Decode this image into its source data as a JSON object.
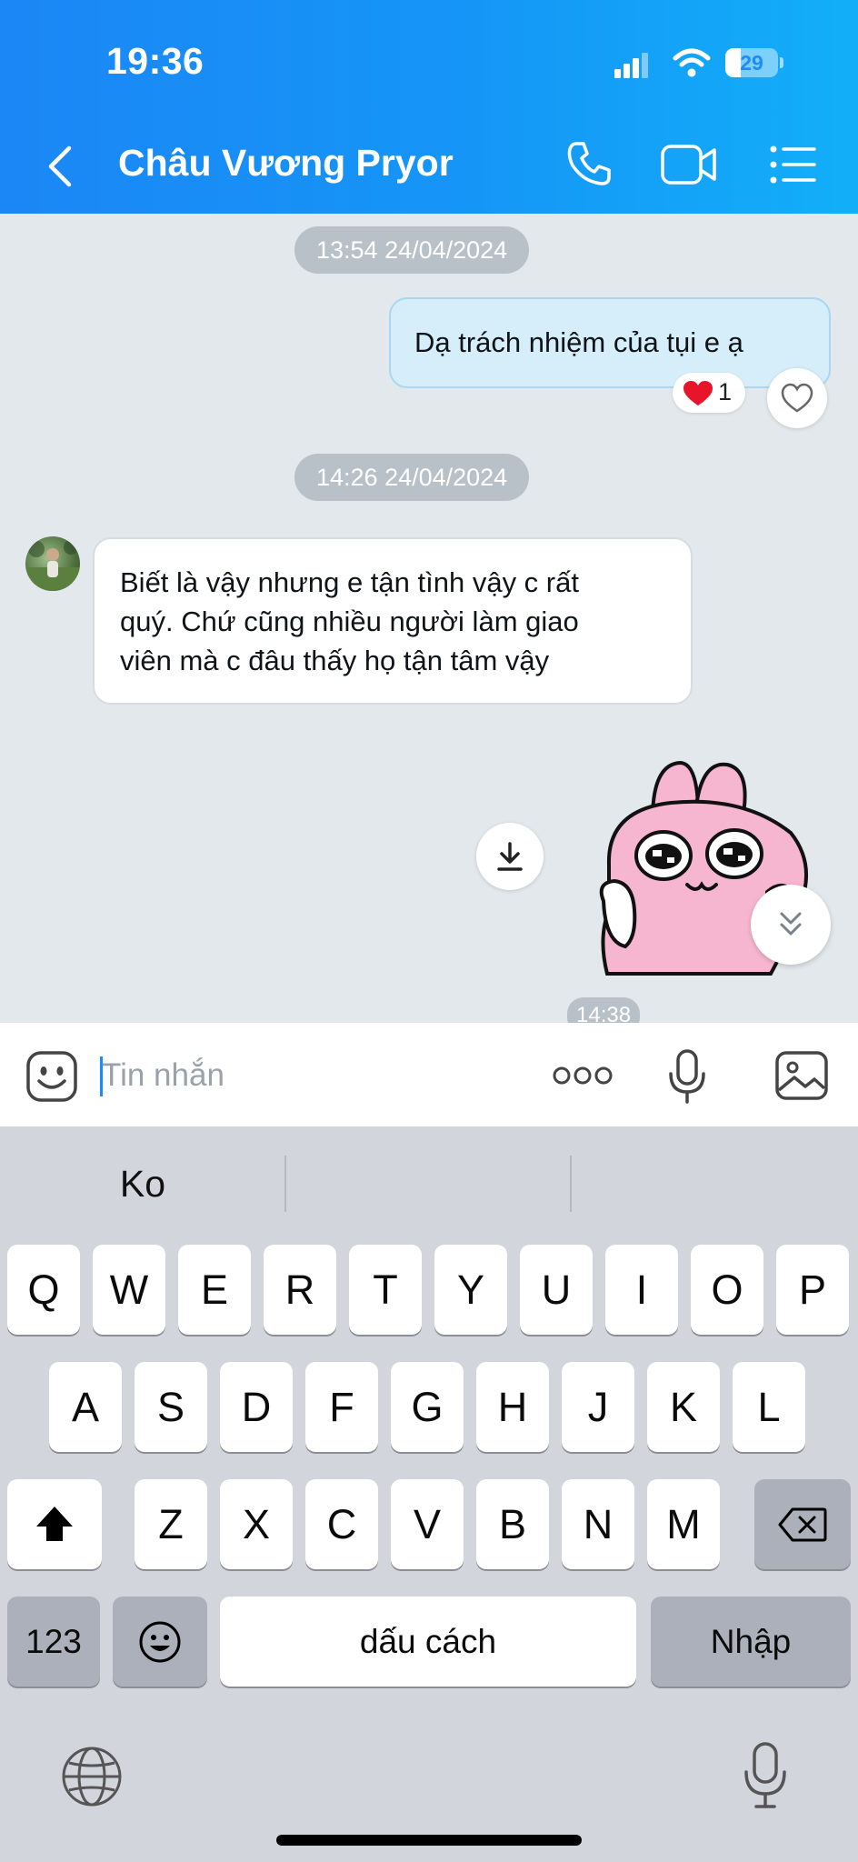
{
  "status_bar": {
    "time": "19:36",
    "battery_level": "29",
    "battery_fraction": 0.29
  },
  "header": {
    "contact_name": "Châu Vương Pryor",
    "theme_color": "#1b86f5"
  },
  "messages": {
    "timestamp_1": "13:54 24/04/2024",
    "outgoing_text": "Dạ trách nhiệm của tụi e ạ",
    "reaction": {
      "emoji": "heart",
      "count": "1"
    },
    "timestamp_2": "14:26 24/04/2024",
    "incoming_lines": [
      "Biết là vậy nhưng e tận tình vậy c rất",
      "quý. Chứ cũng nhiều người làm giao",
      "viên mà c đâu thấy họ tận tâm vậy"
    ],
    "sticker": "pink-bunny-crying-sticker",
    "timestamp_3": "14:38"
  },
  "input_bar": {
    "placeholder": "Tin nhắn"
  },
  "keyboard": {
    "suggestions": [
      "Ko",
      "",
      ""
    ],
    "row1": [
      "Q",
      "W",
      "E",
      "R",
      "T",
      "Y",
      "U",
      "I",
      "O",
      "P"
    ],
    "row2": [
      "A",
      "S",
      "D",
      "F",
      "G",
      "H",
      "J",
      "K",
      "L"
    ],
    "row3": [
      "Z",
      "X",
      "C",
      "V",
      "B",
      "N",
      "M"
    ],
    "numbers_label": "123",
    "space_label": "dấu cách",
    "return_label": "Nhập"
  }
}
